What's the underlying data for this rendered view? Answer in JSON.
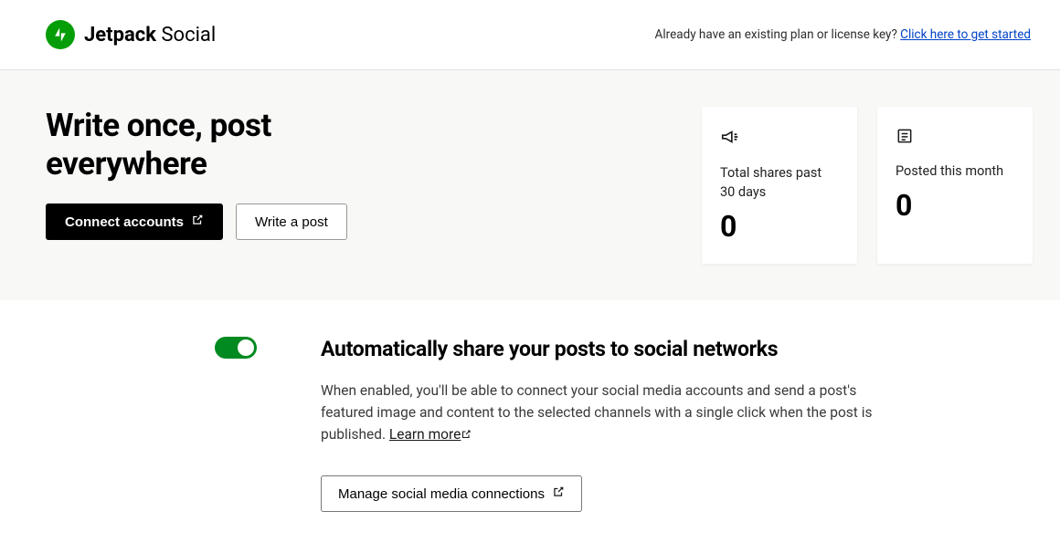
{
  "header": {
    "brand_bold": "Jetpack",
    "brand_light": "Social",
    "existing_text": "Already have an existing plan or license key? ",
    "existing_link": "Click here to get started"
  },
  "hero": {
    "title_line1": "Write once, post",
    "title_line2": "everywhere",
    "connect_btn": "Connect accounts",
    "write_btn": "Write a post"
  },
  "stats": {
    "shares": {
      "label": "Total shares past 30 days",
      "value": "0"
    },
    "posted": {
      "label": "Posted this month",
      "value": "0"
    }
  },
  "settings": {
    "title": "Automatically share your posts to social networks",
    "description": "When enabled, you'll be able to connect your social media accounts and send a post's featured image and content to the selected channels with a single click when the post is published. ",
    "learn_more": "Learn more",
    "manage_btn": "Manage social media connections"
  }
}
